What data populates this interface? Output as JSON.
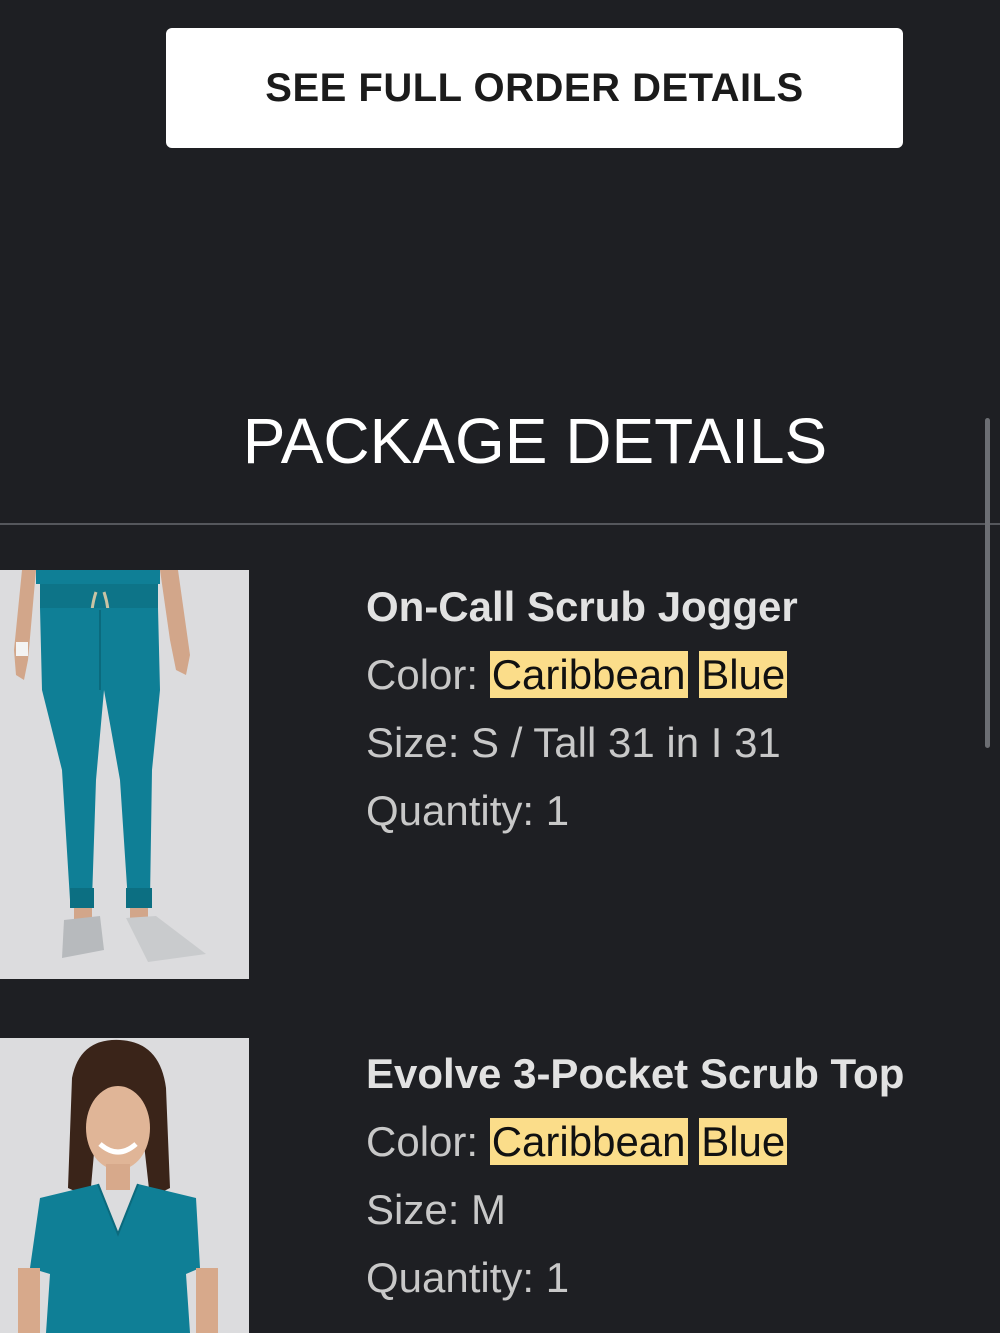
{
  "order_button": {
    "label": "SEE FULL ORDER DETAILS"
  },
  "package": {
    "title": "PACKAGE DETAILS",
    "items": [
      {
        "name": "On-Call Scrub Jogger",
        "color_label": "Color:",
        "color_word1": "Caribbean",
        "color_word2": "Blue",
        "size_text": "Size: S / Tall 31  in I 31",
        "quantity_text": "Quantity: 1"
      },
      {
        "name": "Evolve 3-Pocket Scrub Top",
        "color_label": "Color:",
        "color_word1": "Caribbean",
        "color_word2": "Blue",
        "size_text": "Size: M",
        "quantity_text": "Quantity: 1"
      }
    ]
  },
  "colors": {
    "background": "#1e1f23",
    "highlight": "#fbdd8a",
    "product_teal": "#0f7f96"
  }
}
